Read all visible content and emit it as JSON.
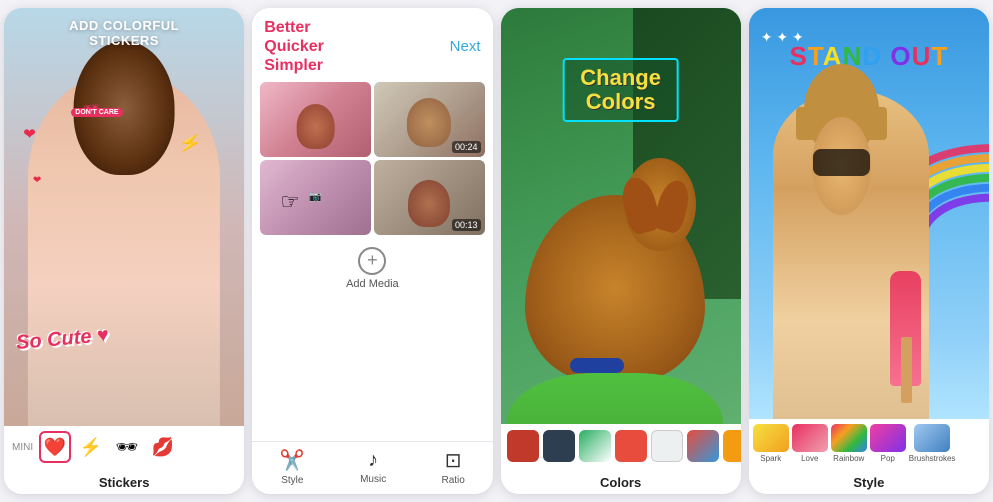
{
  "panels": [
    {
      "id": "stickers",
      "title": "ADD COLORFUL\nSTICKERS",
      "label": "Stickers",
      "sticker_bar": [
        "❤️",
        "⚡",
        "🕶",
        "💋"
      ],
      "sticker_bar_mini": "MINI",
      "so_cute": "So Cute ♥"
    },
    {
      "id": "media",
      "title_line1": "Better",
      "title_line2": "Quicker",
      "title_line3": "Simpler",
      "next_label": "Next",
      "add_media_label": "Add Media",
      "durations": [
        "00:24",
        "00:13"
      ],
      "toolbar": [
        {
          "label": "Style",
          "icon": "✂️"
        },
        {
          "label": "Music",
          "icon": "♪"
        },
        {
          "label": "Ratio",
          "icon": "⊡"
        }
      ]
    },
    {
      "id": "colors",
      "label": "Colors",
      "change_colors_text": "Change\nColors",
      "swatches": [
        {
          "color": "#c0392b",
          "selected": false
        },
        {
          "color": "#2c3e50",
          "selected": false
        },
        {
          "color": "#27ae60",
          "selected": false
        },
        {
          "color": "#e74c3c",
          "selected": false
        },
        {
          "color": "#ecf0f1",
          "selected": false
        },
        {
          "color": "#3498db",
          "selected": false
        },
        {
          "color": "#f39c12",
          "selected": false
        }
      ]
    },
    {
      "id": "style",
      "label": "Style",
      "stand_out_text": "STAND OUT",
      "style_swatches": [
        {
          "label": "Spark",
          "colors": [
            "#f7e040",
            "#f0a020"
          ]
        },
        {
          "label": "Love",
          "colors": [
            "#e83060",
            "#f0a0b0"
          ]
        },
        {
          "label": "Rainbow",
          "colors": [
            "#e83060",
            "#f7a020",
            "#30b840",
            "#3080f0"
          ]
        },
        {
          "label": "Pop",
          "colors": [
            "#f040a0",
            "#8030e8"
          ]
        },
        {
          "label": "Brushstrokes",
          "colors": [
            "#a0c8f0",
            "#4080c0"
          ]
        }
      ]
    }
  ]
}
